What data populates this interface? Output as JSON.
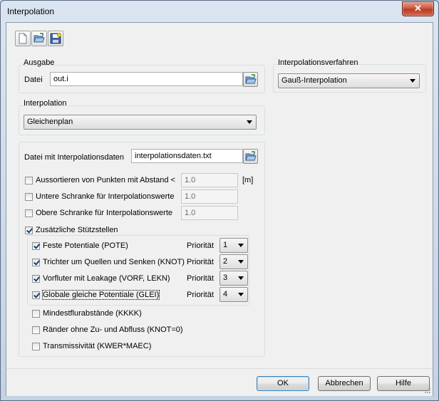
{
  "window": {
    "title": "Interpolation",
    "close_label": "✕"
  },
  "toolbar": {
    "new_icon": "new-document-icon",
    "open_icon": "open-folder-icon",
    "save_icon": "save-disk-icon"
  },
  "ausgabe": {
    "group_label": "Ausgabe",
    "datei_label": "Datei",
    "datei_value": "out.i"
  },
  "interpolationsverfahren": {
    "group_label": "Interpolationsverfahren",
    "selected": "Gauß-Interpolation"
  },
  "interpolation": {
    "group_label": "Interpolation",
    "selected": "Gleichenplan"
  },
  "daten": {
    "datei_label": "Datei mit Interpolationsdaten",
    "datei_value": "interpolationsdaten.txt",
    "options": [
      {
        "label": "Aussortieren von Punkten mit Abstand <",
        "value": "1.0",
        "unit": "[m]",
        "checked": false
      },
      {
        "label": "Untere Schranke für Interpolationswerte",
        "value": "1.0",
        "checked": false
      },
      {
        "label": "Obere Schranke für Interpolationswerte",
        "value": "1.0",
        "checked": false
      }
    ],
    "zusaetzlich_label": "Zusätzliche Stützstellen",
    "zusaetzlich_checked": true,
    "prioritaet_label": "Priorität",
    "stuetz": [
      {
        "label": "Feste Potentiale (POTE)",
        "checked": true,
        "priority": "1"
      },
      {
        "label": "Trichter um Quellen und Senken (KNOT)",
        "checked": true,
        "priority": "2"
      },
      {
        "label": "Vorfluter mit Leakage (VORF, LEKN)",
        "checked": true,
        "priority": "3"
      },
      {
        "label": "Globale gleiche Potentiale (GLEI)",
        "checked": true,
        "priority": "4"
      }
    ],
    "extra": [
      {
        "label": "Mindestflurabstände (KKKK)",
        "checked": false
      },
      {
        "label": "Ränder ohne Zu- und Abfluss (KNOT=0)",
        "checked": false
      },
      {
        "label": "Transmissivität (KWER*MAEC)",
        "checked": false
      }
    ]
  },
  "buttons": {
    "ok": "OK",
    "abbrechen": "Abbrechen",
    "hilfe": "Hilfe"
  }
}
